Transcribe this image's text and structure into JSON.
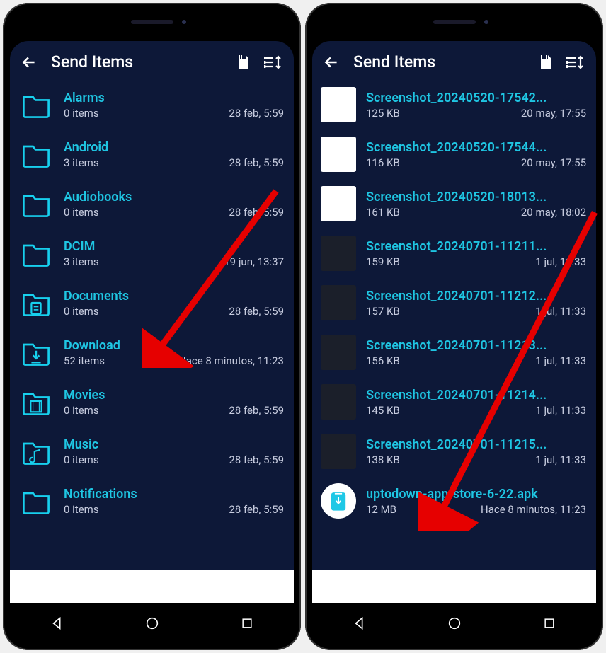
{
  "left": {
    "header": {
      "title": "Send Items"
    },
    "items": [
      {
        "name": "Alarms",
        "sub": "0 items",
        "date": "28 feb, 5:59",
        "icon": "folder"
      },
      {
        "name": "Android",
        "sub": "3 items",
        "date": "28 feb, 5:59",
        "icon": "folder"
      },
      {
        "name": "Audiobooks",
        "sub": "0 items",
        "date": "28 feb, 5:59",
        "icon": "folder"
      },
      {
        "name": "DCIM",
        "sub": "3 items",
        "date": "19 jun, 13:37",
        "icon": "folder"
      },
      {
        "name": "Documents",
        "sub": "0 items",
        "date": "28 feb, 5:59",
        "icon": "folder-doc"
      },
      {
        "name": "Download",
        "sub": "52 items",
        "date": "Hace 8 minutos, 11:23",
        "icon": "folder-download"
      },
      {
        "name": "Movies",
        "sub": "0 items",
        "date": "28 feb, 5:59",
        "icon": "folder-movie"
      },
      {
        "name": "Music",
        "sub": "0 items",
        "date": "28 feb, 5:59",
        "icon": "folder-music"
      },
      {
        "name": "Notifications",
        "sub": "0 items",
        "date": "28 feb, 5:59",
        "icon": "folder"
      }
    ]
  },
  "right": {
    "header": {
      "title": "Send Items"
    },
    "items": [
      {
        "name": "Screenshot_20240520-17542...",
        "sub": "125 KB",
        "date": "20 may, 17:55",
        "thumb": "light"
      },
      {
        "name": "Screenshot_20240520-17544...",
        "sub": "116 KB",
        "date": "20 may, 17:55",
        "thumb": "light"
      },
      {
        "name": "Screenshot_20240520-18013...",
        "sub": "161 KB",
        "date": "20 may, 18:02",
        "thumb": "light"
      },
      {
        "name": "Screenshot_20240701-11211...",
        "sub": "159 KB",
        "date": "1 jul, 11:33",
        "thumb": "dark"
      },
      {
        "name": "Screenshot_20240701-11212...",
        "sub": "157 KB",
        "date": "1 jul, 11:33",
        "thumb": "dark"
      },
      {
        "name": "Screenshot_20240701-11213...",
        "sub": "156 KB",
        "date": "1 jul, 11:33",
        "thumb": "dark"
      },
      {
        "name": "Screenshot_20240701-11214...",
        "sub": "145 KB",
        "date": "1 jul, 11:33",
        "thumb": "dark"
      },
      {
        "name": "Screenshot_20240701-11215...",
        "sub": "138 KB",
        "date": "1 jul, 11:33",
        "thumb": "dark"
      },
      {
        "name": "uptodown-app-store-6-22.apk",
        "sub": "12 MB",
        "date": "Hace 8 minutos, 11:23",
        "thumb": "apk"
      }
    ]
  }
}
